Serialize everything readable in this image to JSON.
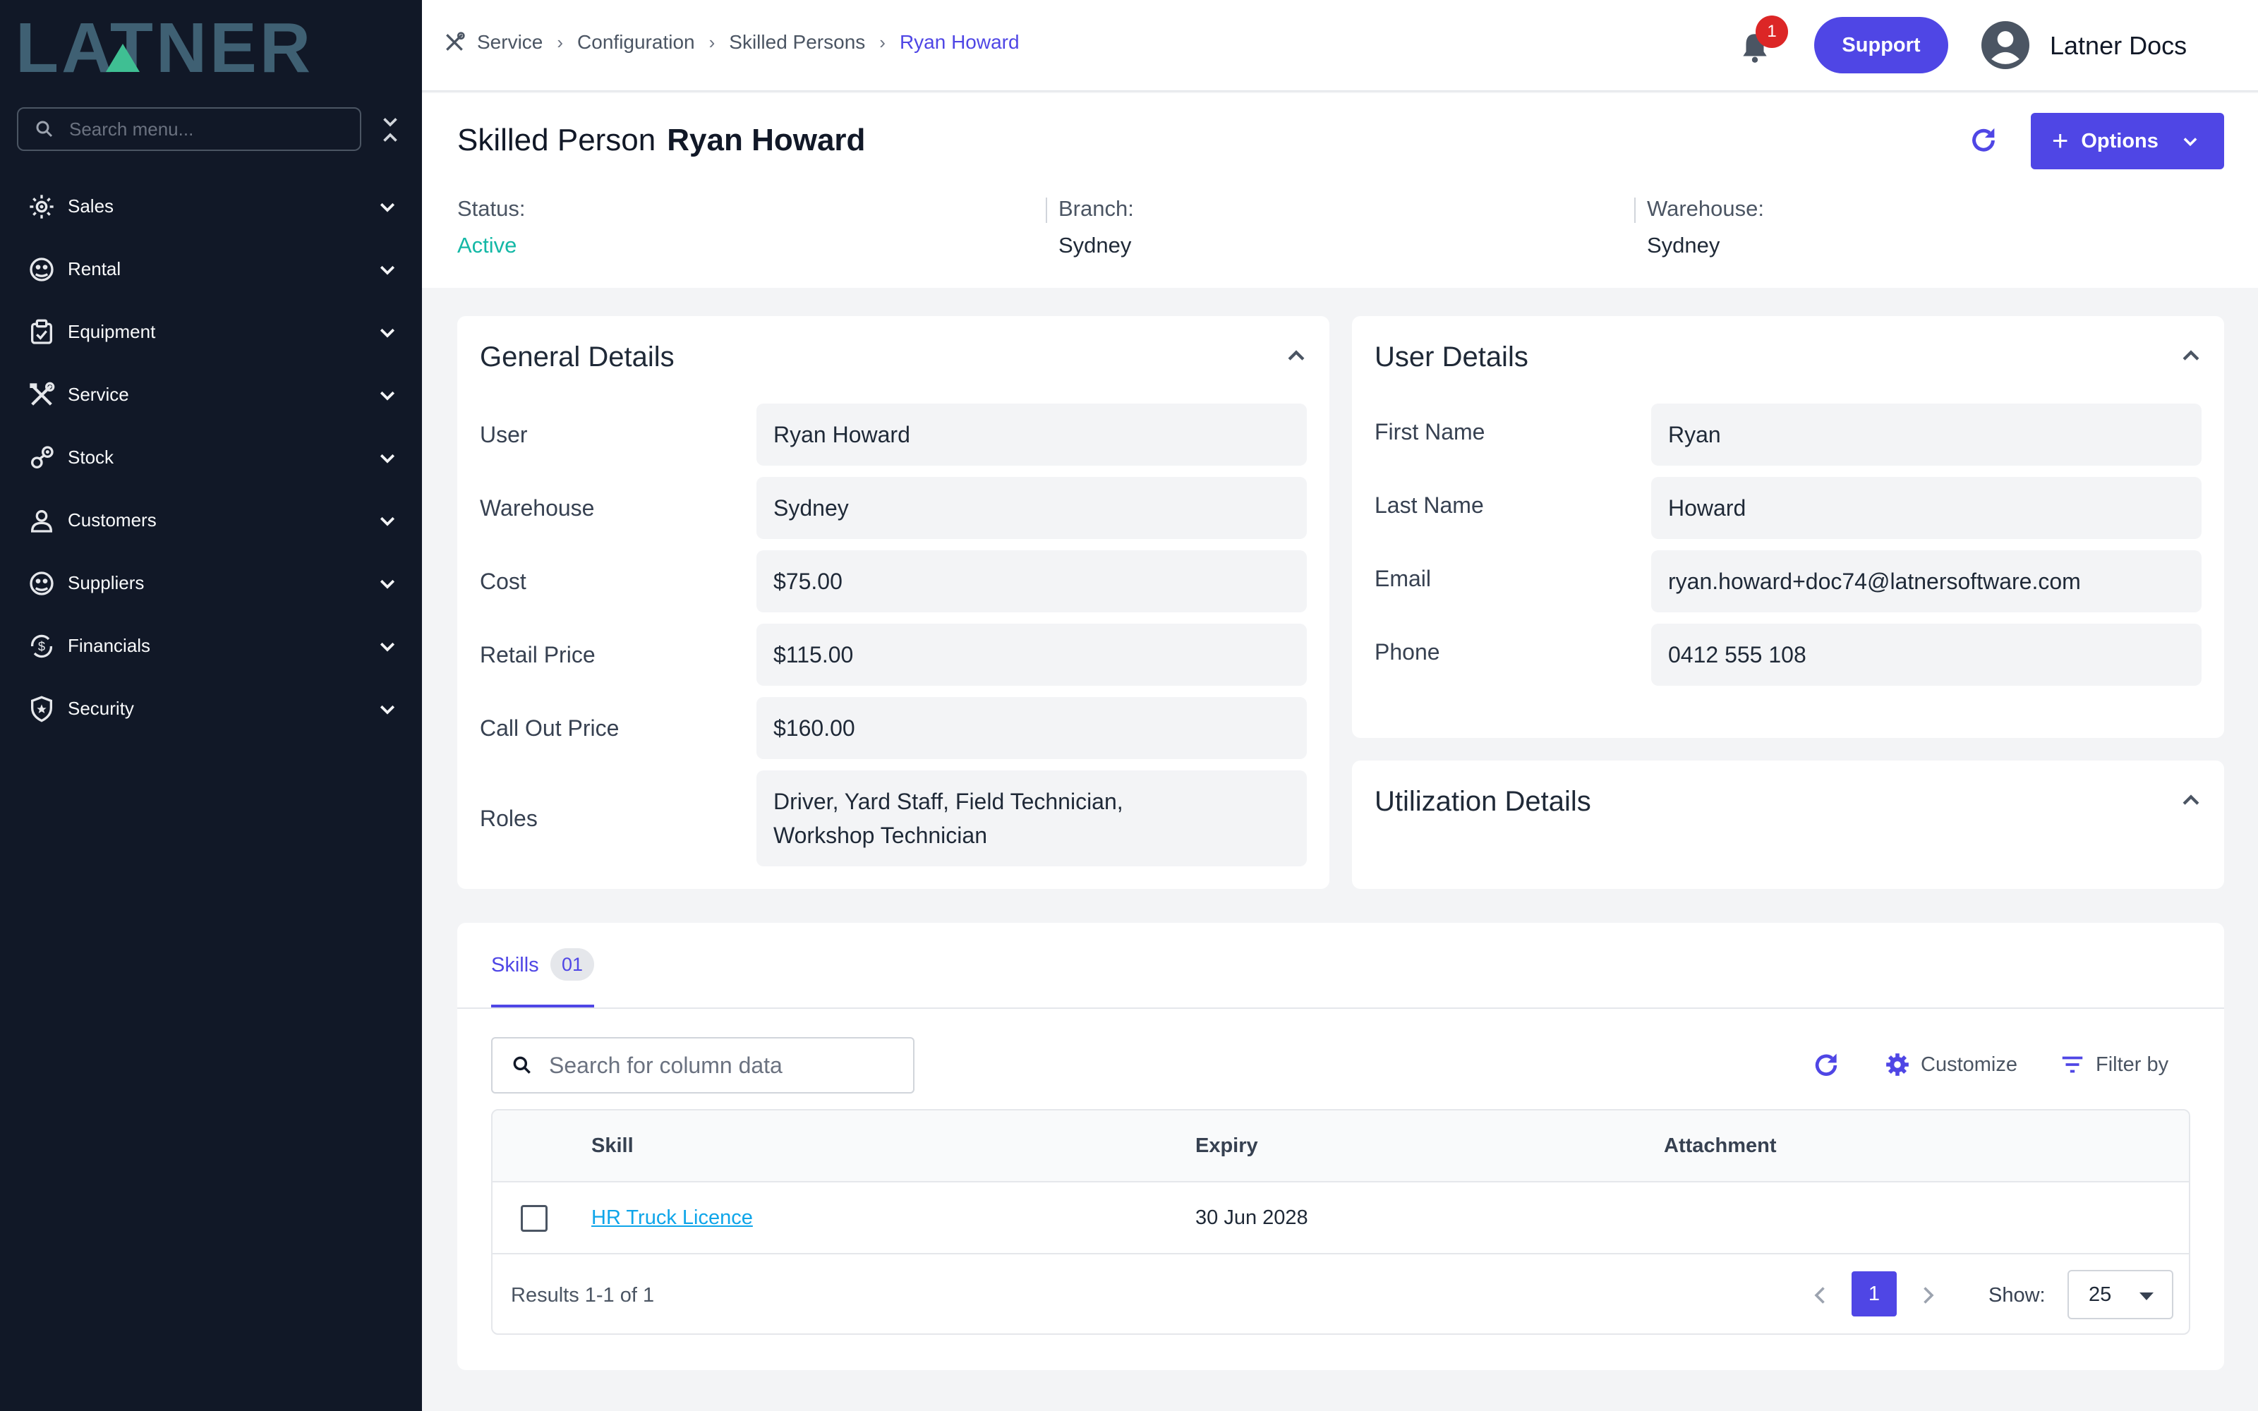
{
  "app": {
    "logo_text": "LATNER",
    "menu_search_placeholder": "Search menu..."
  },
  "sidebar": {
    "items": [
      {
        "label": "Sales",
        "icon": "sales-icon"
      },
      {
        "label": "Rental",
        "icon": "rental-icon"
      },
      {
        "label": "Equipment",
        "icon": "equipment-icon"
      },
      {
        "label": "Service",
        "icon": "service-icon"
      },
      {
        "label": "Stock",
        "icon": "stock-icon"
      },
      {
        "label": "Customers",
        "icon": "customers-icon"
      },
      {
        "label": "Suppliers",
        "icon": "suppliers-icon"
      },
      {
        "label": "Financials",
        "icon": "financials-icon"
      },
      {
        "label": "Security",
        "icon": "security-icon"
      }
    ]
  },
  "topbar": {
    "breadcrumbs": [
      "Service",
      "Configuration",
      "Skilled Persons",
      "Ryan Howard"
    ],
    "notification_count": "1",
    "support_label": "Support",
    "user_name": "Latner Docs"
  },
  "header": {
    "title_prefix": "Skilled Person",
    "title_name": "Ryan Howard",
    "options_label": "Options",
    "status_label": "Status:",
    "status_value": "Active",
    "branch_label": "Branch:",
    "branch_value": "Sydney",
    "warehouse_label": "Warehouse:",
    "warehouse_value": "Sydney"
  },
  "general": {
    "title": "General Details",
    "rows": [
      {
        "label": "User",
        "value": "Ryan Howard"
      },
      {
        "label": "Warehouse",
        "value": "Sydney"
      },
      {
        "label": "Cost",
        "value": "$75.00"
      },
      {
        "label": "Retail Price",
        "value": "$115.00"
      },
      {
        "label": "Call Out Price",
        "value": "$160.00"
      },
      {
        "label": "Roles",
        "value": "Driver, Yard Staff, Field Technician,",
        "value2": "Workshop Technician"
      }
    ]
  },
  "user_details": {
    "title": "User Details",
    "rows": [
      {
        "label": "First Name",
        "value": "Ryan"
      },
      {
        "label": "Last Name",
        "value": "Howard"
      },
      {
        "label": "Email",
        "value": "ryan.howard+doc74@latnersoftware.com"
      },
      {
        "label": "Phone",
        "value": "0412 555 108"
      }
    ]
  },
  "utilization": {
    "title": "Utilization Details"
  },
  "skills": {
    "tab_label": "Skills",
    "tab_count": "01",
    "search_placeholder": "Search for column data",
    "customize_label": "Customize",
    "filter_label": "Filter by",
    "columns": [
      "Skill",
      "Expiry",
      "Attachment"
    ],
    "rows": [
      {
        "skill": "HR Truck Licence",
        "expiry": "30 Jun 2028",
        "attachment": ""
      }
    ],
    "results_text": "Results 1-1 of 1",
    "current_page": "1",
    "show_label": "Show:",
    "page_size": "25"
  },
  "colors": {
    "accent": "#4f46e5",
    "sidebar_bg": "#111827",
    "status_active": "#14b8a6",
    "badge": "#dc2626"
  }
}
